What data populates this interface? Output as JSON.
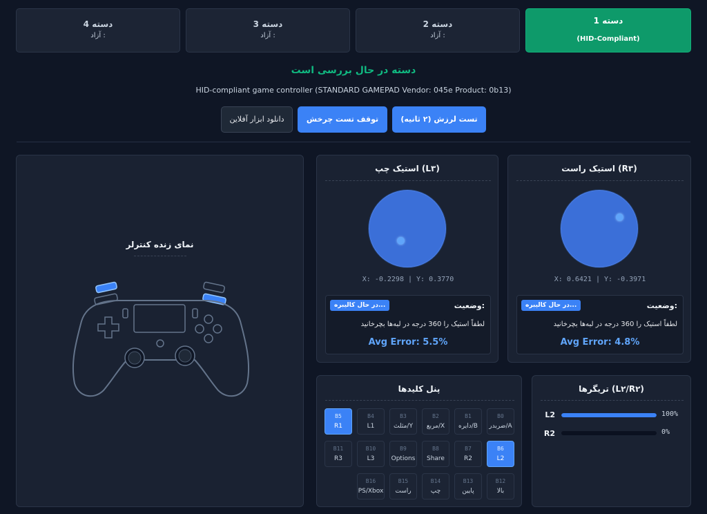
{
  "tabs": [
    {
      "title": "دسته 1",
      "sub": "(HID-Compliant)",
      "active": true
    },
    {
      "title": "دسته 2",
      "sub": "آزاد :"
    },
    {
      "title": "دسته 3",
      "sub": "آزاد :"
    },
    {
      "title": "دسته 4",
      "sub": "آزاد :"
    }
  ],
  "status": {
    "title": "دسته در حال بررسی است",
    "device": "HID-compliant game controller (STANDARD GAMEPAD Vendor: 045e Product: 0b13)"
  },
  "actions": {
    "vibration": "تست لرزش (۲ ثانیه)",
    "stop_rotation": "توقف تست چرخش",
    "download": "دانلود ابزار آفلاین"
  },
  "live_view": {
    "title": "نمای زنده کنترلر"
  },
  "sticks": {
    "right": {
      "title": "استیک راست (R۳)",
      "coords": "X: 0.6421 | Y: -0.3971",
      "x": 0.6421,
      "y": -0.3971,
      "status_label": "وضعیت:",
      "badge": "در حال کالیبره...",
      "hint": "لطفاً استیک را 360 درجه در لبه‌ها بچرخانید",
      "avg_error": "Avg Error: 4.8%"
    },
    "left": {
      "title": "استیک چپ (L۳)",
      "coords": "X: -0.2298 | Y: 0.3770",
      "x": -0.2298,
      "y": 0.377,
      "status_label": "وضعیت:",
      "badge": "در حال کالیبره...",
      "hint": "لطفاً استیک را 360 درجه در لبه‌ها بچرخانید",
      "avg_error": "Avg Error: 5.5%"
    }
  },
  "triggers": {
    "title": "تریگرها (L۲/R۲)",
    "items": [
      {
        "label": "L2",
        "value": 1.0,
        "text": "100%"
      },
      {
        "label": "R2",
        "value": 0.0,
        "text": "0%"
      }
    ]
  },
  "keys": {
    "title": "پنل کلیدها",
    "rows": [
      [
        {
          "id": "B0",
          "label": "ضربدر/A"
        },
        {
          "id": "B1",
          "label": "دایره/B"
        },
        {
          "id": "B2",
          "label": "مربع/X"
        },
        {
          "id": "B3",
          "label": "مثلث/Y"
        },
        {
          "id": "B4",
          "label": "L1"
        },
        {
          "id": "B5",
          "label": "R1",
          "pressed": true
        }
      ],
      [
        {
          "id": "B6",
          "label": "L2",
          "pressed": true
        },
        {
          "id": "B7",
          "label": "R2"
        },
        {
          "id": "B8",
          "label": "Share"
        },
        {
          "id": "B9",
          "label": "Options"
        },
        {
          "id": "B10",
          "label": "L3"
        },
        {
          "id": "B11",
          "label": "R3"
        }
      ],
      [
        {
          "id": "B12",
          "label": "بالا"
        },
        {
          "id": "B13",
          "label": "پایین"
        },
        {
          "id": "B14",
          "label": "چپ"
        },
        {
          "id": "B15",
          "label": "راست"
        },
        {
          "id": "B16",
          "label": "PS/Xbox"
        }
      ]
    ]
  }
}
